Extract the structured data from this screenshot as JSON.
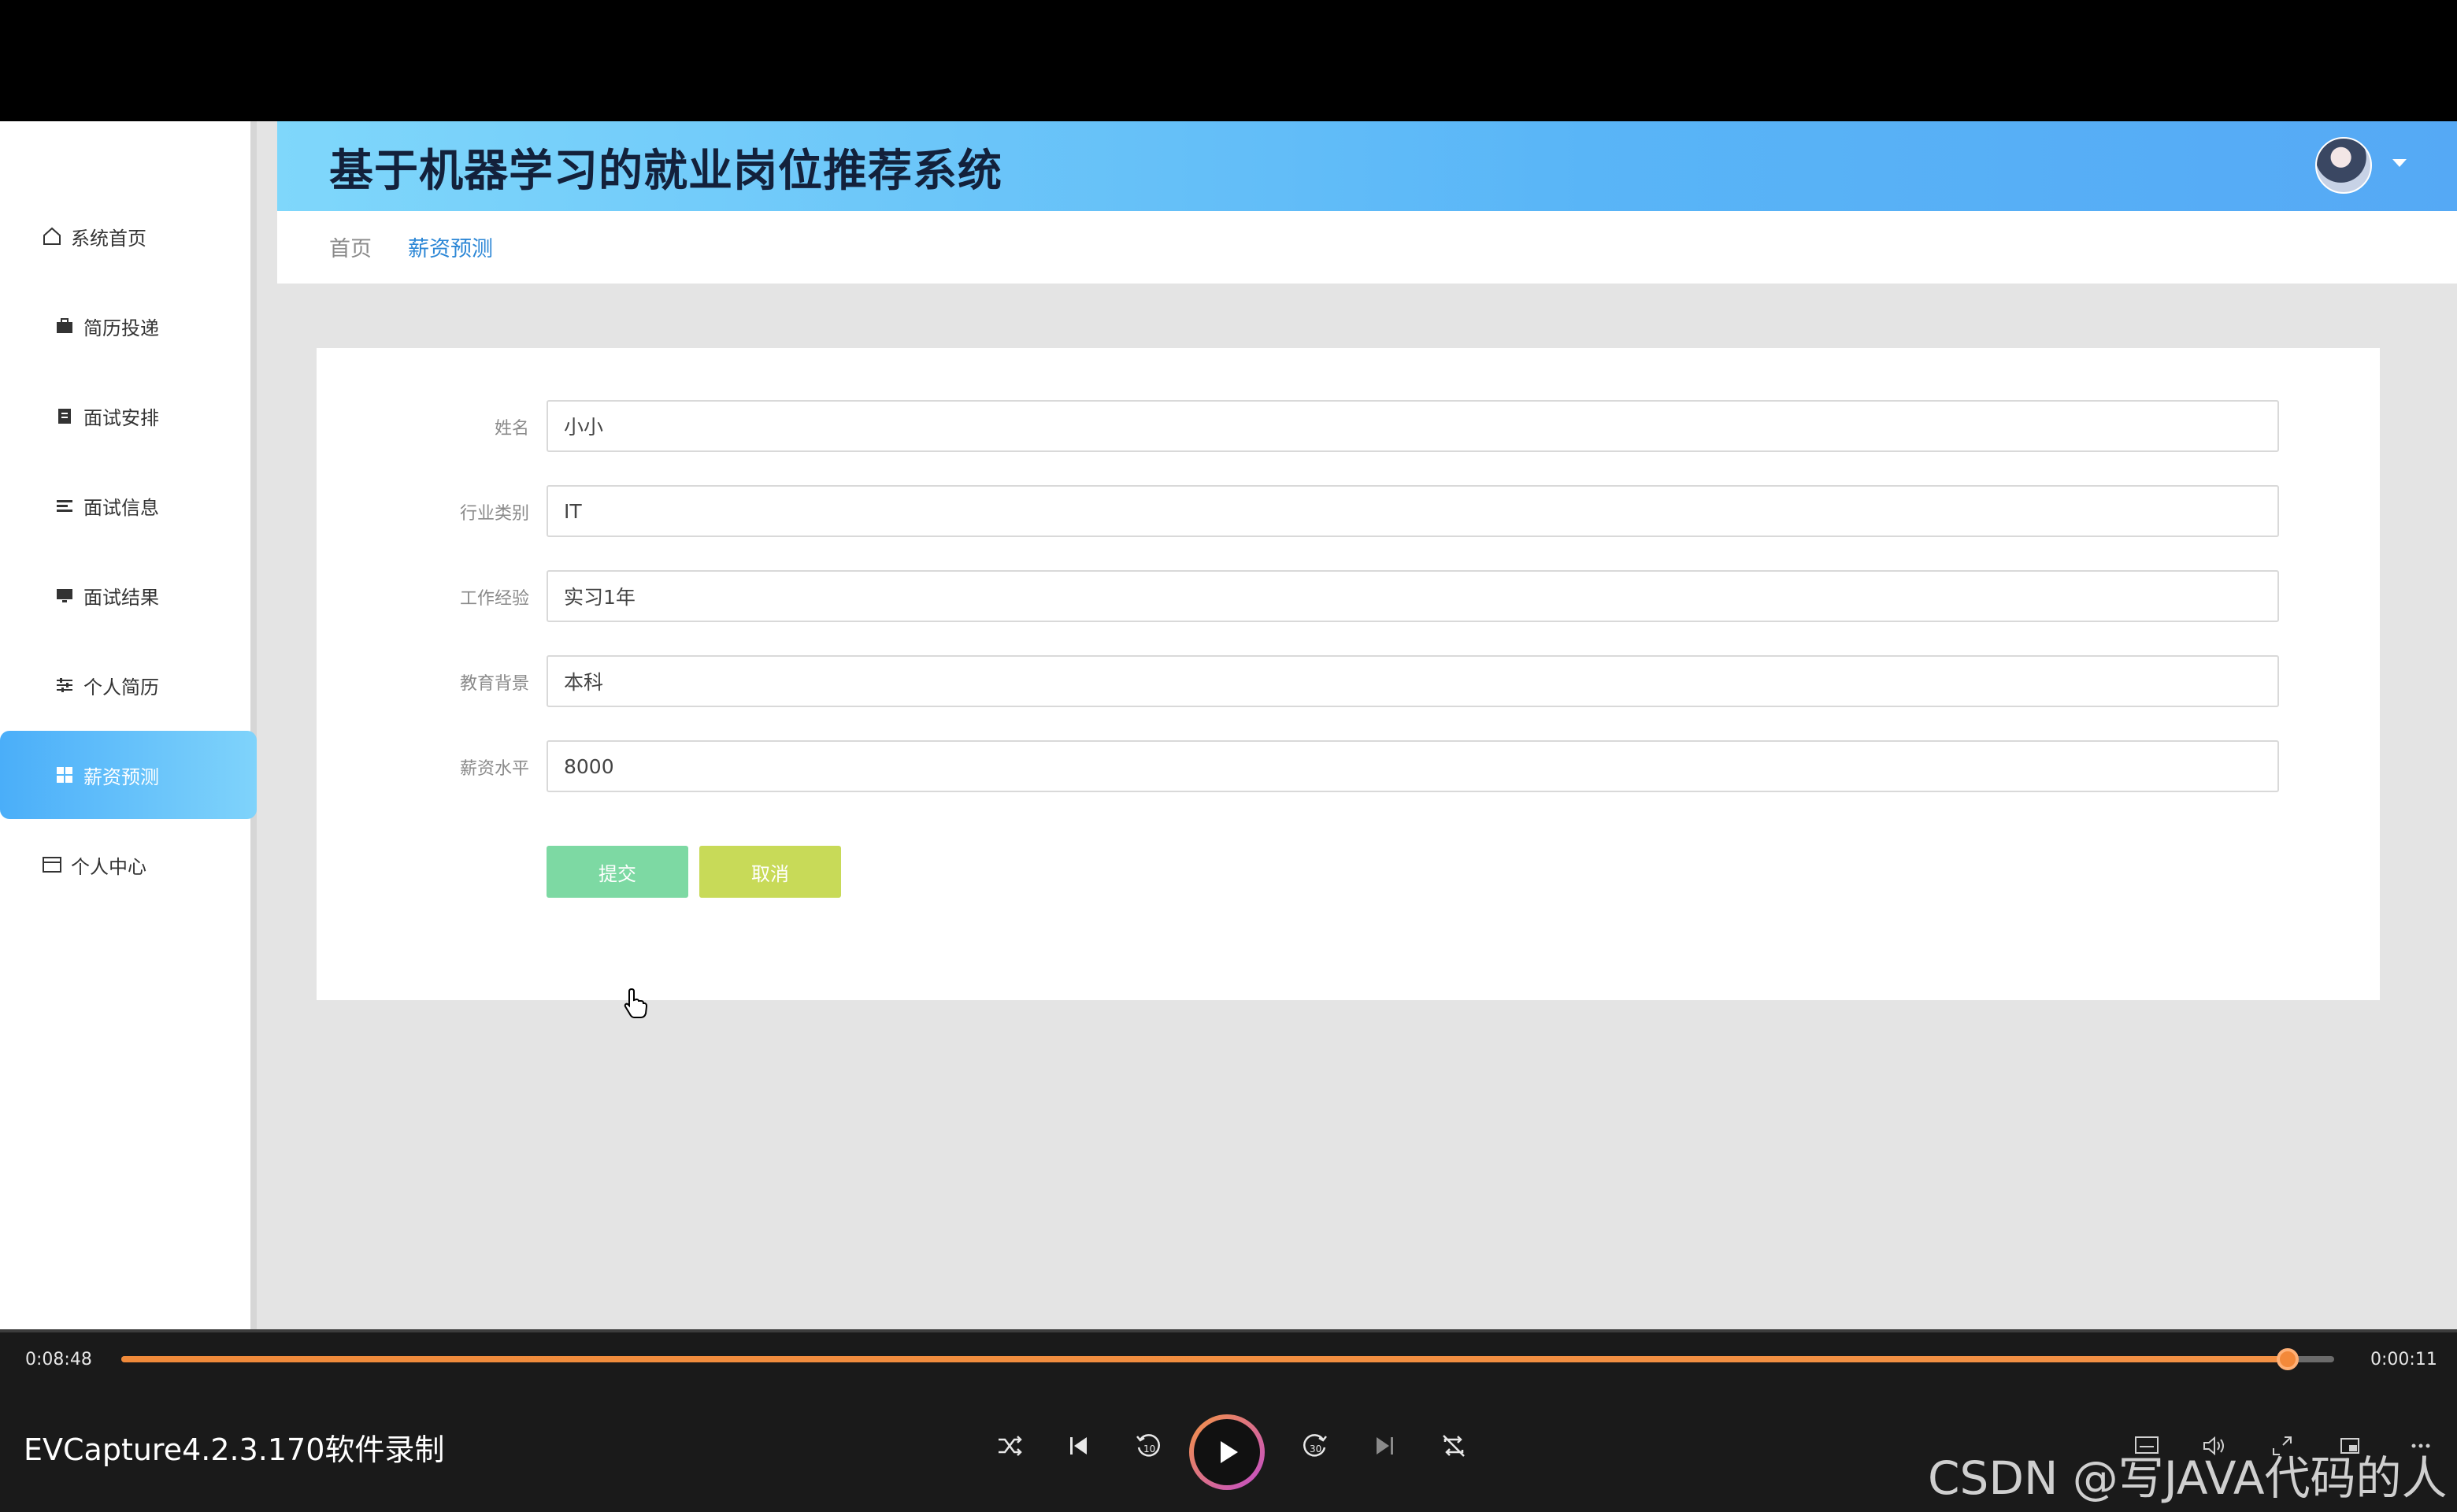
{
  "header": {
    "title": "基于机器学习的就业岗位推荐系统"
  },
  "sidebar": {
    "items": [
      {
        "label": "系统首页",
        "icon": "home-icon"
      },
      {
        "label": "简历投递",
        "icon": "briefcase-icon"
      },
      {
        "label": "面试安排",
        "icon": "clipboard-icon"
      },
      {
        "label": "面试信息",
        "icon": "list-icon"
      },
      {
        "label": "面试结果",
        "icon": "monitor-icon"
      },
      {
        "label": "个人简历",
        "icon": "sliders-icon"
      },
      {
        "label": "薪资预测",
        "icon": "grid-icon",
        "active": true
      },
      {
        "label": "个人中心",
        "icon": "card-icon"
      }
    ]
  },
  "breadcrumb": {
    "home": "首页",
    "current": "薪资预测"
  },
  "form": {
    "fields": [
      {
        "label": "姓名",
        "value": "小小"
      },
      {
        "label": "行业类别",
        "value": "IT"
      },
      {
        "label": "工作经验",
        "value": "实习1年"
      },
      {
        "label": "教育背景",
        "value": "本科"
      },
      {
        "label": "薪资水平",
        "value": "8000"
      }
    ],
    "submit_label": "提交",
    "cancel_label": "取消"
  },
  "player": {
    "elapsed": "0:08:48",
    "remaining": "0:00:11",
    "progress": 0.979,
    "recorder_title": "EVCapture4.2.3.170软件录制",
    "watermark": "CSDN @写JAVA代码的人",
    "accent": "#f3893a"
  }
}
